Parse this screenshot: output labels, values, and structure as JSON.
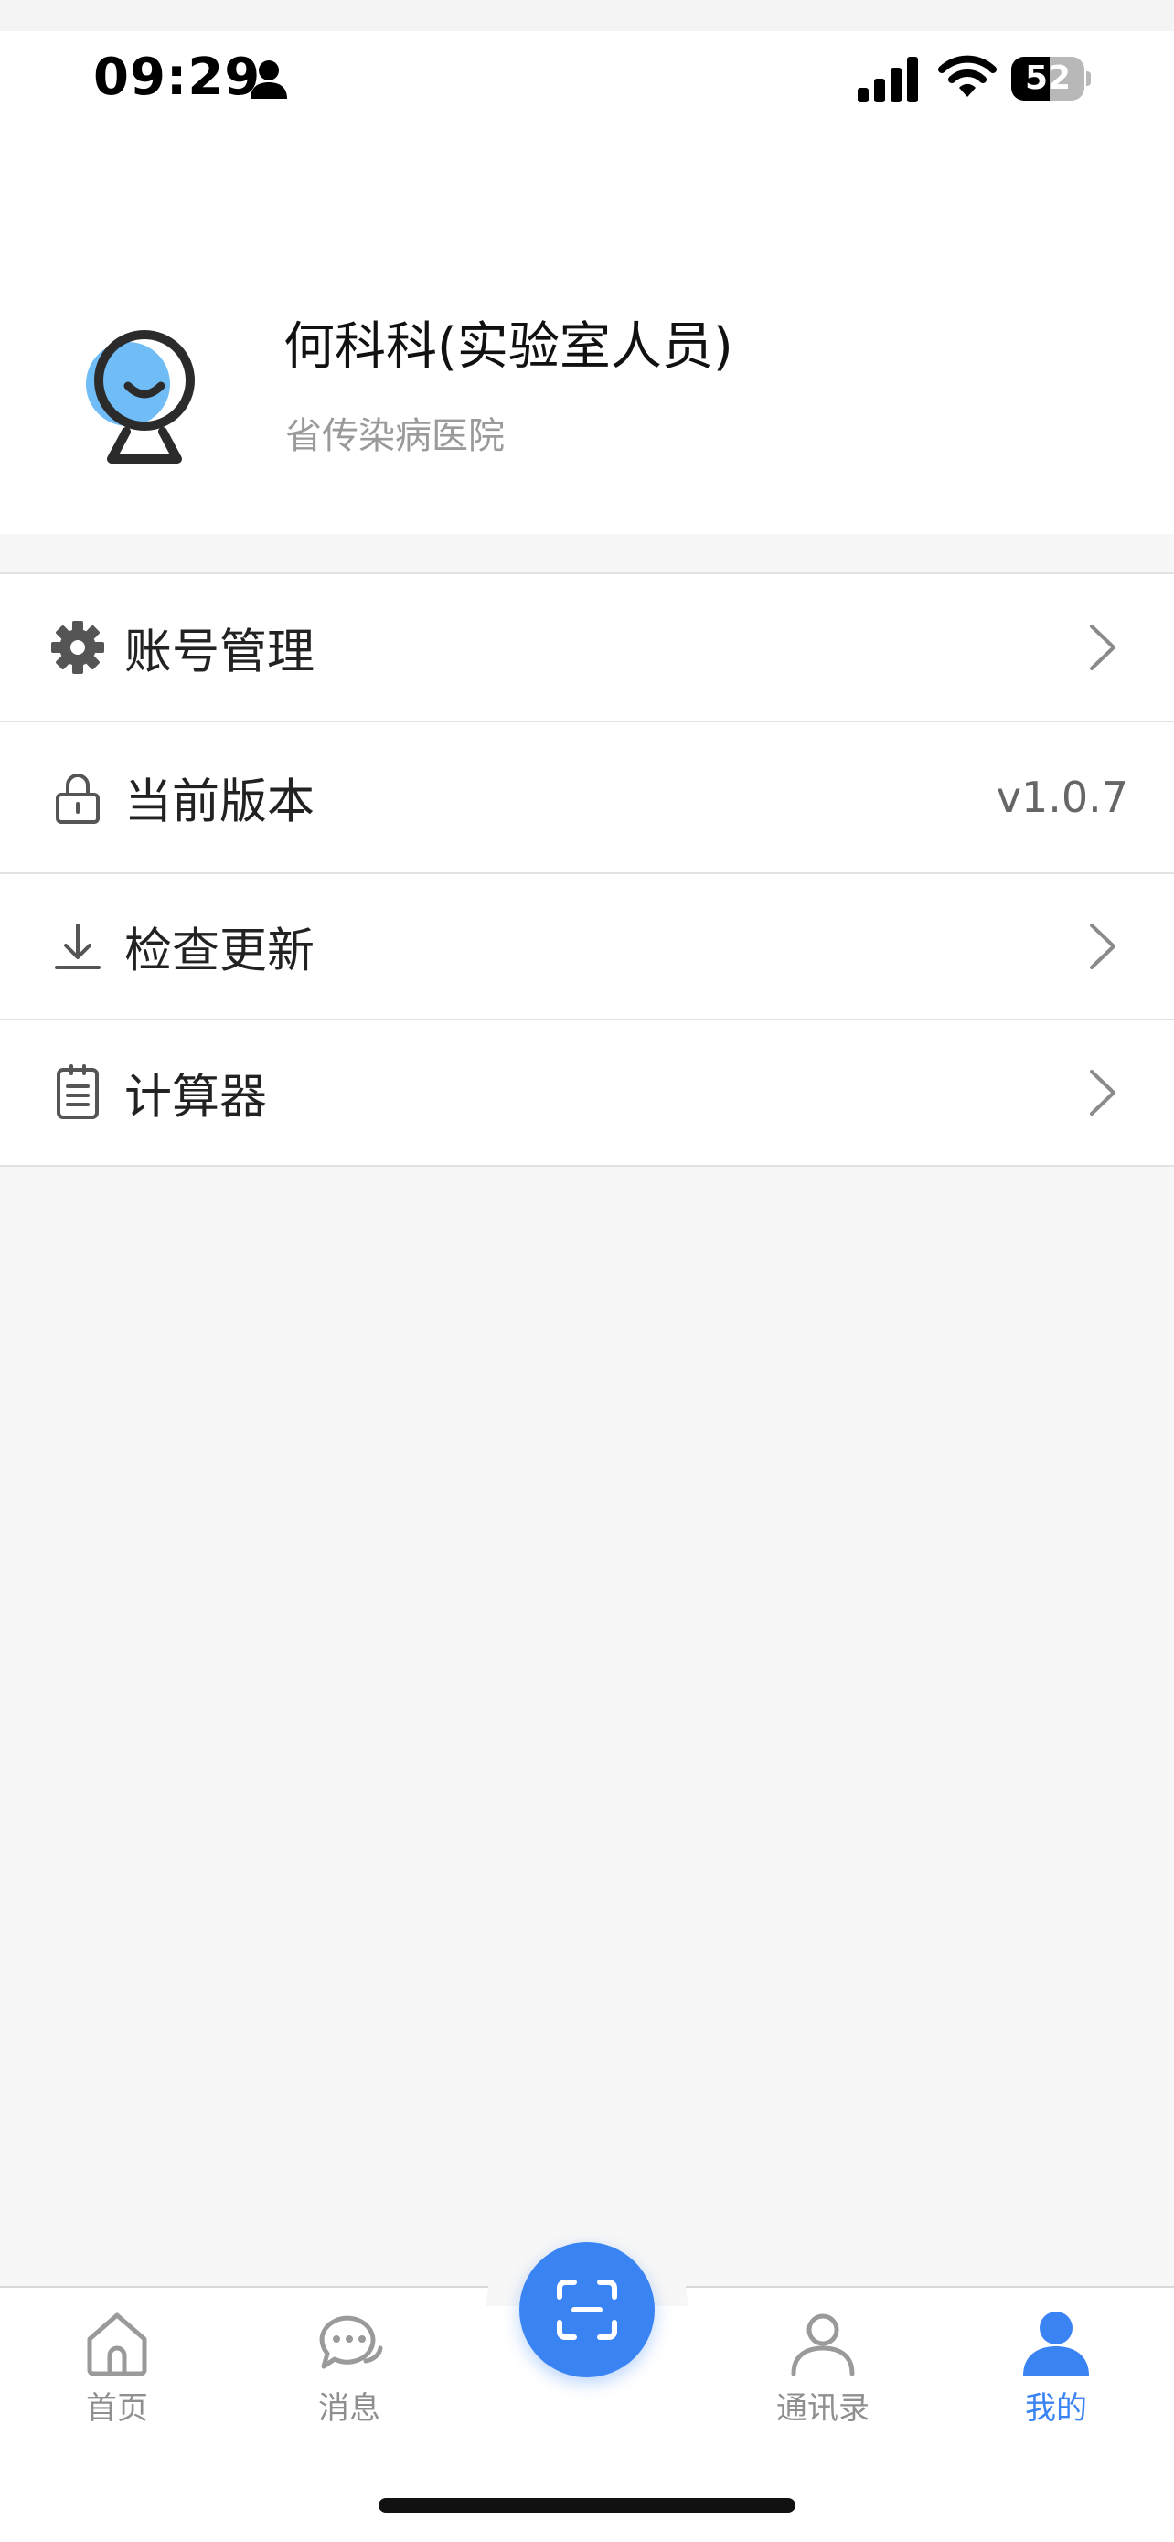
{
  "status_bar": {
    "time": "09:29",
    "battery_level": "52",
    "battery_fraction": 0.52,
    "icons": [
      "person-icon",
      "cellular-signal-icon",
      "wifi-icon",
      "battery-icon"
    ]
  },
  "profile": {
    "name": "何科科(实验室人员)",
    "organization": "省传染病医院",
    "avatar_icon": "avatar-icon"
  },
  "menu": {
    "items": [
      {
        "label": "账号管理",
        "icon": "gear-icon",
        "chevron": true
      },
      {
        "label": "当前版本",
        "icon": "lock-icon",
        "value": "v1.0.7"
      },
      {
        "label": "检查更新",
        "icon": "download-icon",
        "chevron": true
      },
      {
        "label": "计算器",
        "icon": "clipboard-list-icon",
        "chevron": true
      }
    ]
  },
  "tabbar": {
    "tabs": [
      {
        "label": "首页",
        "icon": "home-icon"
      },
      {
        "label": "消息",
        "icon": "chat-icon"
      },
      {
        "label": "通讯录",
        "icon": "contacts-icon"
      },
      {
        "label": "我的",
        "icon": "profile-icon",
        "active": true
      }
    ],
    "scan_icon": "scan-icon"
  },
  "colors": {
    "accent": "#3a83f3",
    "background": "#f7f7f7",
    "inactive_tab": "#8f8f8f",
    "secondary_text": "#9a9a9a"
  }
}
